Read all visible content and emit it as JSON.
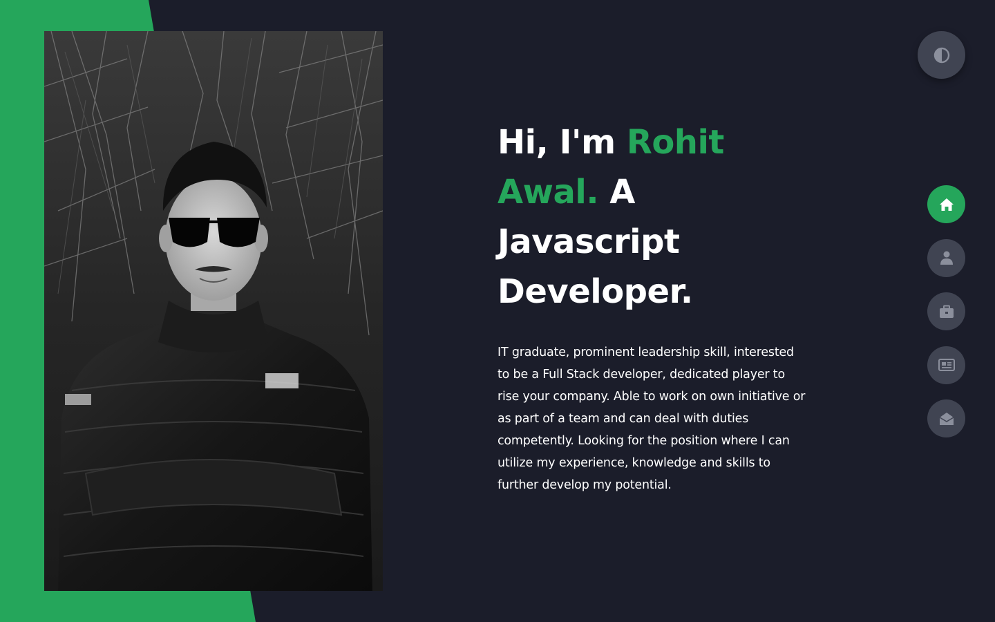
{
  "hero": {
    "greeting": "Hi, I'm ",
    "name": "Rohit Awal.",
    "role": " A Javascript Developer.",
    "intro": "IT graduate, prominent leadership skill, interested to be a Full Stack developer, dedicated player to rise your company. Able to work on own initiative or as part of a team and can deal with duties competently. Looking for the position where I can utilize my experience, knowledge and skills to further develop my potential."
  },
  "theme_toggle": {
    "icon": "contrast-icon"
  },
  "nav": {
    "items": [
      {
        "icon": "home-icon",
        "active": true
      },
      {
        "icon": "user-icon",
        "active": false
      },
      {
        "icon": "briefcase-icon",
        "active": false
      },
      {
        "icon": "newspaper-icon",
        "active": false
      },
      {
        "icon": "envelope-open-icon",
        "active": false
      }
    ]
  },
  "colors": {
    "background": "#1b1d2a",
    "accent": "#25a65b",
    "button": "#404452",
    "text": "#ffffff"
  }
}
